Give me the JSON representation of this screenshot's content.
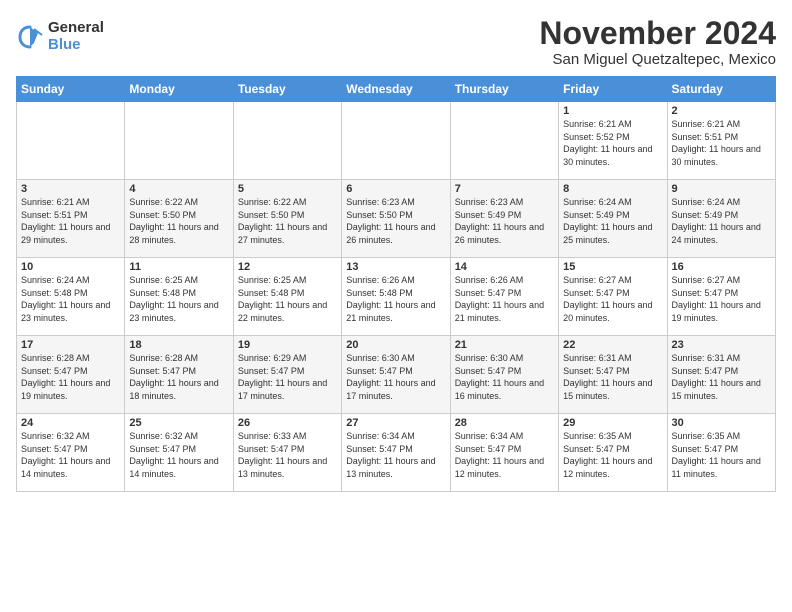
{
  "logo": {
    "general": "General",
    "blue": "Blue"
  },
  "header": {
    "month": "November 2024",
    "location": "San Miguel Quetzaltepec, Mexico"
  },
  "weekdays": [
    "Sunday",
    "Monday",
    "Tuesday",
    "Wednesday",
    "Thursday",
    "Friday",
    "Saturday"
  ],
  "weeks": [
    [
      {
        "day": "",
        "info": ""
      },
      {
        "day": "",
        "info": ""
      },
      {
        "day": "",
        "info": ""
      },
      {
        "day": "",
        "info": ""
      },
      {
        "day": "",
        "info": ""
      },
      {
        "day": "1",
        "info": "Sunrise: 6:21 AM\nSunset: 5:52 PM\nDaylight: 11 hours and 30 minutes."
      },
      {
        "day": "2",
        "info": "Sunrise: 6:21 AM\nSunset: 5:51 PM\nDaylight: 11 hours and 30 minutes."
      }
    ],
    [
      {
        "day": "3",
        "info": "Sunrise: 6:21 AM\nSunset: 5:51 PM\nDaylight: 11 hours and 29 minutes."
      },
      {
        "day": "4",
        "info": "Sunrise: 6:22 AM\nSunset: 5:50 PM\nDaylight: 11 hours and 28 minutes."
      },
      {
        "day": "5",
        "info": "Sunrise: 6:22 AM\nSunset: 5:50 PM\nDaylight: 11 hours and 27 minutes."
      },
      {
        "day": "6",
        "info": "Sunrise: 6:23 AM\nSunset: 5:50 PM\nDaylight: 11 hours and 26 minutes."
      },
      {
        "day": "7",
        "info": "Sunrise: 6:23 AM\nSunset: 5:49 PM\nDaylight: 11 hours and 26 minutes."
      },
      {
        "day": "8",
        "info": "Sunrise: 6:24 AM\nSunset: 5:49 PM\nDaylight: 11 hours and 25 minutes."
      },
      {
        "day": "9",
        "info": "Sunrise: 6:24 AM\nSunset: 5:49 PM\nDaylight: 11 hours and 24 minutes."
      }
    ],
    [
      {
        "day": "10",
        "info": "Sunrise: 6:24 AM\nSunset: 5:48 PM\nDaylight: 11 hours and 23 minutes."
      },
      {
        "day": "11",
        "info": "Sunrise: 6:25 AM\nSunset: 5:48 PM\nDaylight: 11 hours and 23 minutes."
      },
      {
        "day": "12",
        "info": "Sunrise: 6:25 AM\nSunset: 5:48 PM\nDaylight: 11 hours and 22 minutes."
      },
      {
        "day": "13",
        "info": "Sunrise: 6:26 AM\nSunset: 5:48 PM\nDaylight: 11 hours and 21 minutes."
      },
      {
        "day": "14",
        "info": "Sunrise: 6:26 AM\nSunset: 5:47 PM\nDaylight: 11 hours and 21 minutes."
      },
      {
        "day": "15",
        "info": "Sunrise: 6:27 AM\nSunset: 5:47 PM\nDaylight: 11 hours and 20 minutes."
      },
      {
        "day": "16",
        "info": "Sunrise: 6:27 AM\nSunset: 5:47 PM\nDaylight: 11 hours and 19 minutes."
      }
    ],
    [
      {
        "day": "17",
        "info": "Sunrise: 6:28 AM\nSunset: 5:47 PM\nDaylight: 11 hours and 19 minutes."
      },
      {
        "day": "18",
        "info": "Sunrise: 6:28 AM\nSunset: 5:47 PM\nDaylight: 11 hours and 18 minutes."
      },
      {
        "day": "19",
        "info": "Sunrise: 6:29 AM\nSunset: 5:47 PM\nDaylight: 11 hours and 17 minutes."
      },
      {
        "day": "20",
        "info": "Sunrise: 6:30 AM\nSunset: 5:47 PM\nDaylight: 11 hours and 17 minutes."
      },
      {
        "day": "21",
        "info": "Sunrise: 6:30 AM\nSunset: 5:47 PM\nDaylight: 11 hours and 16 minutes."
      },
      {
        "day": "22",
        "info": "Sunrise: 6:31 AM\nSunset: 5:47 PM\nDaylight: 11 hours and 15 minutes."
      },
      {
        "day": "23",
        "info": "Sunrise: 6:31 AM\nSunset: 5:47 PM\nDaylight: 11 hours and 15 minutes."
      }
    ],
    [
      {
        "day": "24",
        "info": "Sunrise: 6:32 AM\nSunset: 5:47 PM\nDaylight: 11 hours and 14 minutes."
      },
      {
        "day": "25",
        "info": "Sunrise: 6:32 AM\nSunset: 5:47 PM\nDaylight: 11 hours and 14 minutes."
      },
      {
        "day": "26",
        "info": "Sunrise: 6:33 AM\nSunset: 5:47 PM\nDaylight: 11 hours and 13 minutes."
      },
      {
        "day": "27",
        "info": "Sunrise: 6:34 AM\nSunset: 5:47 PM\nDaylight: 11 hours and 13 minutes."
      },
      {
        "day": "28",
        "info": "Sunrise: 6:34 AM\nSunset: 5:47 PM\nDaylight: 11 hours and 12 minutes."
      },
      {
        "day": "29",
        "info": "Sunrise: 6:35 AM\nSunset: 5:47 PM\nDaylight: 11 hours and 12 minutes."
      },
      {
        "day": "30",
        "info": "Sunrise: 6:35 AM\nSunset: 5:47 PM\nDaylight: 11 hours and 11 minutes."
      }
    ]
  ]
}
